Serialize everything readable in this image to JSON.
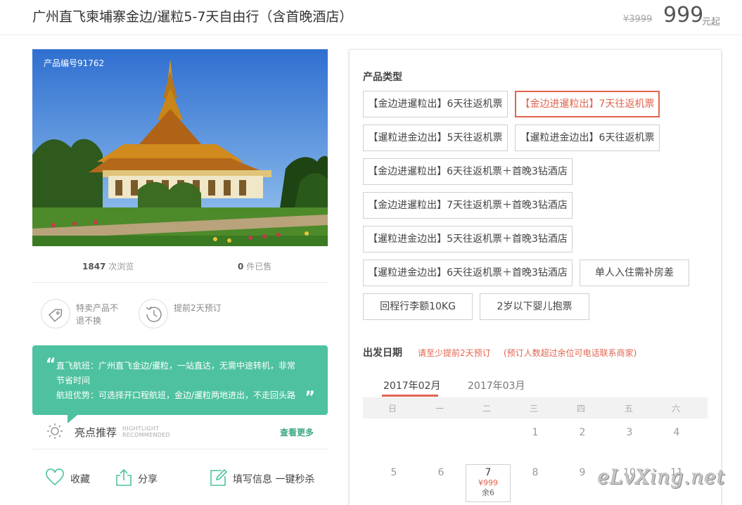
{
  "header": {
    "title": "广州直飞柬埔寨金边/暹粒5-7天自由行（含首晚酒店）",
    "original_price": "¥3999",
    "price": "999",
    "price_suffix": "元起"
  },
  "gallery": {
    "product_code": "产品编号91762"
  },
  "stats": {
    "views_count": "1847",
    "views_label": "次浏览",
    "sold_count": "0",
    "sold_label": "件已售"
  },
  "policies": [
    {
      "icon": "tag-icon",
      "text": "特卖产品不退不换"
    },
    {
      "icon": "clock-icon",
      "text": "提前2天预订"
    }
  ],
  "highlight": {
    "line1": "直飞航班：广州直飞金边/暹粒，一站直达，无需中途转机，非常节省时间",
    "line2": "航班优势：可选择开口程航班，金边/暹粒两地进出，不走回头路",
    "label": "亮点推荐",
    "label_en_1": "HIGHTLIGHT",
    "label_en_2": "RECOMMENDED",
    "more": "查看更多"
  },
  "actions": {
    "favorite": "收藏",
    "share": "分享",
    "fill_info": "填写信息 一键秒杀"
  },
  "product_types": {
    "label": "产品类型",
    "selected_index": 1,
    "options": [
      "【金边进暹粒出】6天往返机票",
      "【金边进暹粒出】7天往返机票",
      "【暹粒进金边出】5天往返机票",
      "【暹粒进金边出】6天往返机票",
      "【金边进暹粒出】6天往返机票＋首晚3钻酒店",
      "【金边进暹粒出】7天往返机票＋首晚3钻酒店",
      "【暹粒进金边出】5天往返机票＋首晚3钻酒店",
      "【暹粒进金边出】6天往返机票＋首晚3钻酒店",
      "单人入住需补房差",
      "回程行李额10KG",
      "2岁以下婴儿抱票"
    ]
  },
  "departure": {
    "label": "出发日期",
    "note": "请至少提前2天预订",
    "note2": "(预订人数超过余位可电话联系商家)",
    "months": [
      "2017年02月",
      "2017年03月"
    ],
    "active_month": "2017年02月",
    "weekdays": [
      "日",
      "一",
      "二",
      "三",
      "四",
      "五",
      "六"
    ],
    "week1": [
      "",
      "",
      "",
      "1",
      "2",
      "3",
      "4"
    ],
    "week2": [
      "5",
      "6",
      "7",
      "8",
      "9",
      "10",
      "11"
    ],
    "bookable_day": {
      "day": "7",
      "price": "¥999",
      "remaining": "余6"
    }
  },
  "watermark": "eLvXing.net",
  "colors": {
    "accent": "#e2644f",
    "green": "#4ec2a0"
  }
}
